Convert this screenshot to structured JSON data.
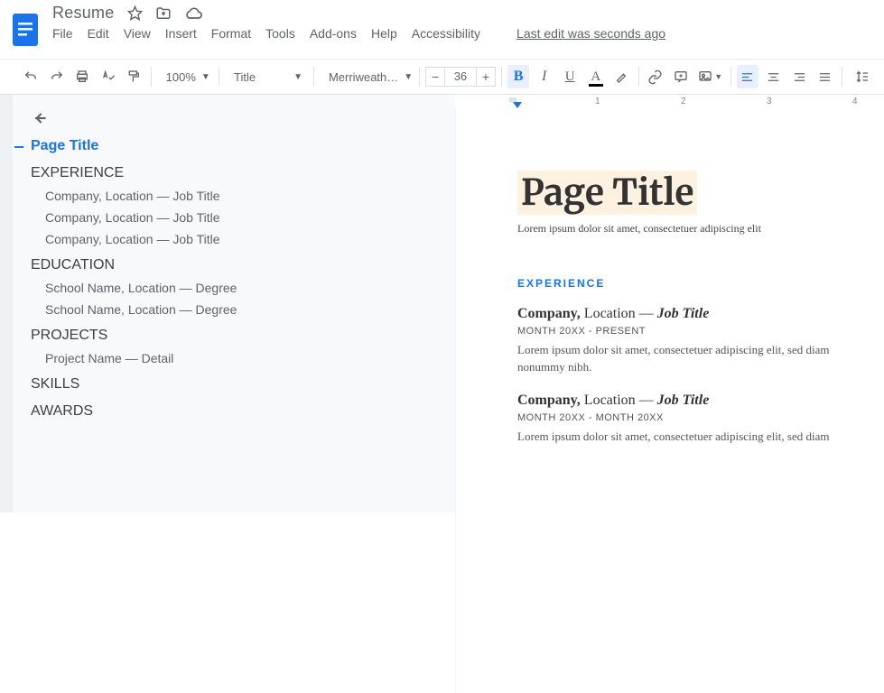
{
  "header": {
    "doc_title": "Resume",
    "menus": [
      "File",
      "Edit",
      "View",
      "Insert",
      "Format",
      "Tools",
      "Add-ons",
      "Help",
      "Accessibility"
    ],
    "last_edit": "Last edit was seconds ago"
  },
  "toolbar": {
    "zoom": "100%",
    "style": "Title",
    "font": "Merriweath…",
    "font_size": "36",
    "text_color_bar": "#000000",
    "highlight_bar": "#ffffff"
  },
  "ruler": {
    "marks": [
      "1",
      "2",
      "3",
      "4"
    ]
  },
  "outline": {
    "title": "Page Title",
    "sections": [
      {
        "heading": "EXPERIENCE",
        "items": [
          "Company, Location — Job Title",
          "Company, Location — Job Title",
          "Company, Location — Job Title"
        ]
      },
      {
        "heading": "EDUCATION",
        "items": [
          "School Name, Location — Degree",
          "School Name, Location — Degree"
        ]
      },
      {
        "heading": "PROJECTS",
        "items": [
          "Project Name — Detail"
        ]
      },
      {
        "heading": "SKILLS",
        "items": []
      },
      {
        "heading": "AWARDS",
        "items": []
      }
    ]
  },
  "document": {
    "title": "Page Title",
    "subtitle": "Lorem ipsum dolor sit amet, consectetuer adipiscing elit",
    "section_heading": "EXPERIENCE",
    "entries": [
      {
        "company": "Company,",
        "location": " Location — ",
        "job": "Job Title",
        "date": "MONTH 20XX - PRESENT",
        "body": "Lorem ipsum dolor sit amet, consectetuer adipiscing elit, sed diam nonummy nibh."
      },
      {
        "company": "Company,",
        "location": " Location — ",
        "job": "Job Title",
        "date": "MONTH 20XX - MONTH 20XX",
        "body": "Lorem ipsum dolor sit amet, consectetuer adipiscing elit, sed diam"
      }
    ]
  }
}
